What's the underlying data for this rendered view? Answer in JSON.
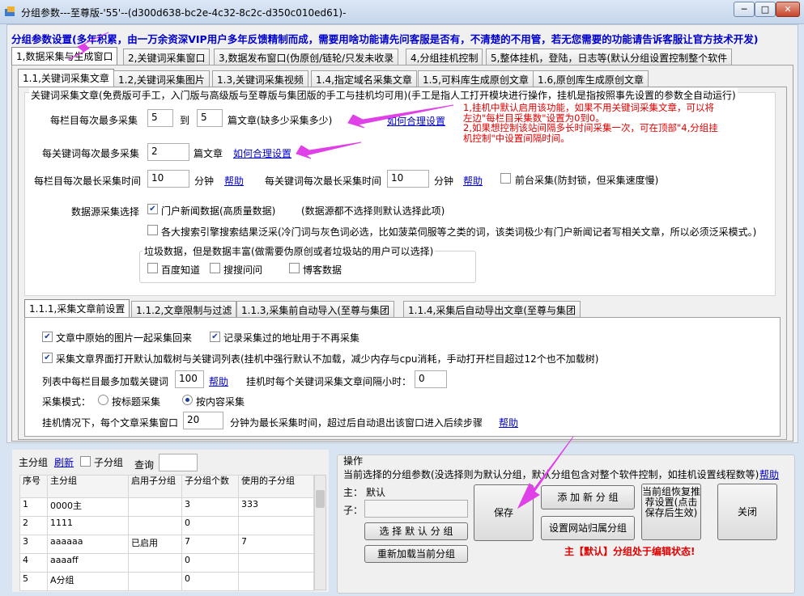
{
  "window": {
    "title": "分组参数---至尊版-'55'--(d300d638-bc2e-4c32-8c2c-d350c010ed61)-",
    "btn_min": "─",
    "btn_max": "□",
    "btn_close": "✕"
  },
  "banner": "分组参数设置(多年积累，由一万余资深VIP用户多年反馈精制而成，需要用啥功能请先问客服是否有，不清楚的不用管，若无您需要的功能请告诉客服让官方技术开发)",
  "tabs1": [
    "1,数据采集与生成窗口",
    "2,关键词采集窗口",
    "3,数据发布窗口(伪原创/链轮/只发未收录",
    "4,分组挂机控制",
    "5,整体挂机，登陆，日志等(默认分组设置控制整个软件"
  ],
  "tabs2": [
    "1.1,关键词采集文章",
    "1.2,关键词采集图片",
    "1.3,关键词采集视频",
    "1.4,指定域名采集文章",
    "1.5,可料库生成原创文章",
    "1.6,原创库生成原创文章"
  ],
  "desc": "关键词采集文章(免费版可手工，入门版与高级版与至尊版与集团版的手工与挂机均可用)(手工是指人工打开模块进行操作，挂机是指按照事先设置的参数全自动运行)",
  "row1": {
    "label": "每栏目每次最多采集",
    "from": "5",
    "to_label": "到",
    "to": "5",
    "suffix": "篇文章(缺多少采集多少)",
    "help": "如何合理设置"
  },
  "note1": "1,挂机中默认启用该功能，如果不用关键词采集文章，可以将左边\"每栏目采集数\"设置为0到0。",
  "note2": "2,如果想控制该站间隔多长时间采集一次，可在顶部\"4,分组挂机控制\"中设置间隔时间。",
  "row2": {
    "label": "每关键词每次最多采集",
    "value": "2",
    "suffix": "篇文章",
    "help": "如何合理设置"
  },
  "row3": {
    "label": "每栏目每次最长采集时间",
    "value": "10",
    "unit": "分钟",
    "help": "帮助",
    "label2": "每关键词每次最长采集时间",
    "value2": "10",
    "unit2": "分钟",
    "help2": "帮助",
    "fg_label": "前台采集(防封锁，但采集速度慢)"
  },
  "source": {
    "label": "数据源采集选择",
    "portal": "门户新闻数据(高质量数据)",
    "portal_note": "(数据源都不选择则默认选择此项)",
    "search": "各大搜索引擎搜索结果泛采(冷门词与灰色词必选，比如菠菜伺服等之类的词，该类词极少有门户新闻记者写相关文章，所以必须泛采模式。)",
    "junk_title": "垃圾数据，但是数据丰富(做需要伪原创或者垃圾站的用户可以选择)",
    "baidu": "百度知道",
    "sousou": "搜搜问问",
    "boke": "博客数据"
  },
  "tabs3": [
    "1.1.1,采集文章前设置",
    "1.1.2,文章限制与过滤",
    "1.1.3,采集前自动导入(至尊与集团",
    "1.1.4,采集后自动导出文章(至尊与集团"
  ],
  "sub": {
    "img": "文章中原始的图片一起采集回来",
    "record": "记录采集过的地址用于不再采集",
    "tree": "采集文章界面打开默认加载树与关键词列表(挂机中强行默认不加载，减少内存与cpu消耗，手动打开栏目超过12个也不加载树)",
    "maxkw_label": "列表中每栏目最多加载关键词",
    "maxkw": "100",
    "help": "帮助",
    "interval_label": "挂机时每个关键词采集文章间隔小时：",
    "interval": "0",
    "mode_label": "采集模式：",
    "mode_title": "按标题采集",
    "mode_content": "按内容采集",
    "window_label": "挂机情况下，每个文章采集窗口",
    "window_value": "20",
    "window_suffix": "分钟为最长采集时间，超过后自动退出该窗口进入后续步骤",
    "help2": "帮助"
  },
  "groups": {
    "label": "主分组",
    "refresh": "刷新",
    "sub_label": "子分组",
    "query": "查询",
    "headers": [
      "序号",
      "主分组",
      "启用子分组",
      "子分组个数",
      "使用的子分组"
    ],
    "rows": [
      [
        "1",
        "0000主",
        "",
        "3",
        "333"
      ],
      [
        "2",
        "1111",
        "",
        "0",
        ""
      ],
      [
        "3",
        "aaaaaa",
        "已启用",
        "7",
        "7"
      ],
      [
        "4",
        "aaaaff",
        "",
        "0",
        ""
      ],
      [
        "5",
        "A分组",
        "",
        "0",
        ""
      ]
    ]
  },
  "ops": {
    "title": "操作",
    "desc": "当前选择的分组参数(没选择则为默认分组，默认分组包含对整个软件控制，如挂机设置线程数等)",
    "help": "帮助",
    "main_label": "主：",
    "main_value": "默认",
    "sub_label": "子：",
    "select_default": "选 择 默 认 分 组",
    "reload": "重新加载当前分组",
    "save": "保存",
    "add": "添 加 新 分 组",
    "set_site": "设置网站归属分组",
    "restore": "当前组恢复推荐设置(点击保存后生效)",
    "close": "关闭",
    "status": "主【默认】分组处于编辑状态!"
  },
  "colors": {
    "accent": "#0000cc",
    "red": "#e00000",
    "arrow": "#e040e8"
  }
}
